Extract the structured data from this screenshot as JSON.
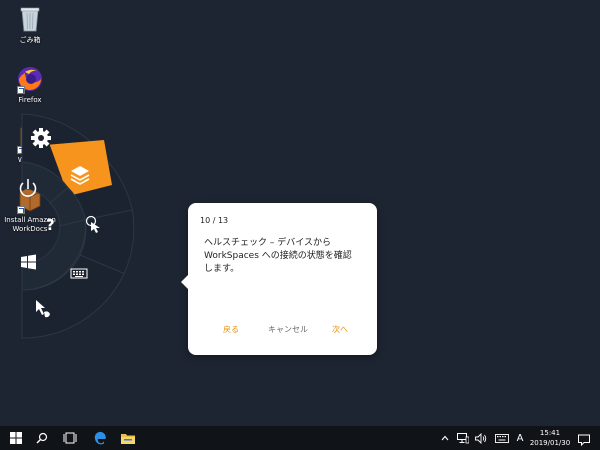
{
  "desktop": {
    "icons": [
      {
        "label": "ごみ箱",
        "icon": "recycle-bin-icon"
      },
      {
        "label": "Firefox",
        "icon": "firefox-icon"
      },
      {
        "label": "WinZip",
        "icon": "winzip-icon"
      },
      {
        "label": "Install Amazon WorkDocs",
        "icon": "workdocs-installer-icon"
      }
    ]
  },
  "radial_menu": {
    "accent_color": "#f7941d",
    "items": [
      "gear-icon",
      "layers-icon",
      "power-icon",
      "help-icon",
      "touch-pointer-icon",
      "keyboard-icon",
      "windows-icon",
      "mouse-pointer-icon"
    ]
  },
  "dialog": {
    "counter": "10 / 13",
    "message": "ヘルスチェック – デバイスから\nWorkSpaces への接続の状態を確認\nします。",
    "back_label": "戻る",
    "cancel_label": "キャンセル",
    "next_label": "次へ",
    "accent_color": "#e8900d"
  },
  "taskbar": {
    "ime_indicator": "A",
    "clock_time": "15:41",
    "clock_date": "2019/01/30"
  }
}
